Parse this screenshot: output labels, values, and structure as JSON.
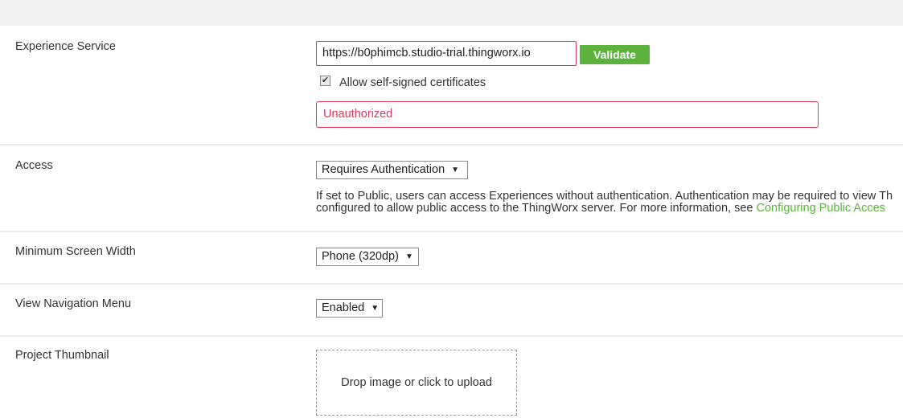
{
  "experience_service": {
    "label": "Experience Service",
    "url_value": "https://b0phimcb.studio-trial.thingworx.io",
    "validate_label": "Validate",
    "self_signed_label": "Allow self-signed certificates",
    "self_signed_checked": true,
    "error_text": "Unauthorized"
  },
  "access": {
    "label": "Access",
    "selected": "Requires Authentication",
    "help_line1": "If set to Public, users can access Experiences without authentication. Authentication may be required to view Th",
    "help_line2_prefix": "configured to allow public access to the ThingWorx server. For more information, see ",
    "help_link": "Configuring Public Acces"
  },
  "min_screen_width": {
    "label": "Minimum Screen Width",
    "selected": "Phone (320dp)"
  },
  "view_nav_menu": {
    "label": "View Navigation Menu",
    "selected": "Enabled"
  },
  "project_thumbnail": {
    "label": "Project Thumbnail",
    "upload_text": "Drop image or click to upload"
  },
  "icons": {
    "checkbox_check": "✔",
    "dropdown_arrow": "▼"
  },
  "colors": {
    "accent_green": "#5bb33b",
    "error_red": "#d9395a"
  }
}
